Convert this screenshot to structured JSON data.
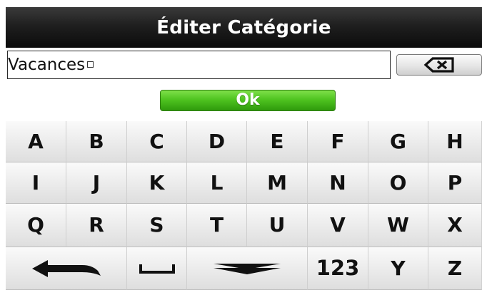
{
  "header": {
    "title": "Éditer Catégorie"
  },
  "input": {
    "value": "Vacances"
  },
  "actions": {
    "backspace_icon": "backspace-icon",
    "ok_label": "Ok",
    "ok_color": "#4fc420"
  },
  "keyboard": {
    "row1": [
      "A",
      "B",
      "C",
      "D",
      "E",
      "F",
      "G",
      "H"
    ],
    "row2": [
      "I",
      "J",
      "K",
      "L",
      "M",
      "N",
      "O",
      "P"
    ],
    "row3": [
      "Q",
      "R",
      "S",
      "T",
      "U",
      "V",
      "W",
      "X"
    ],
    "row4": {
      "back_icon": "back-arrow-icon",
      "space_icon": "space-icon",
      "hide_icon": "hide-keyboard-icon",
      "numbers_label": "123",
      "y_label": "Y",
      "z_label": "Z"
    }
  }
}
